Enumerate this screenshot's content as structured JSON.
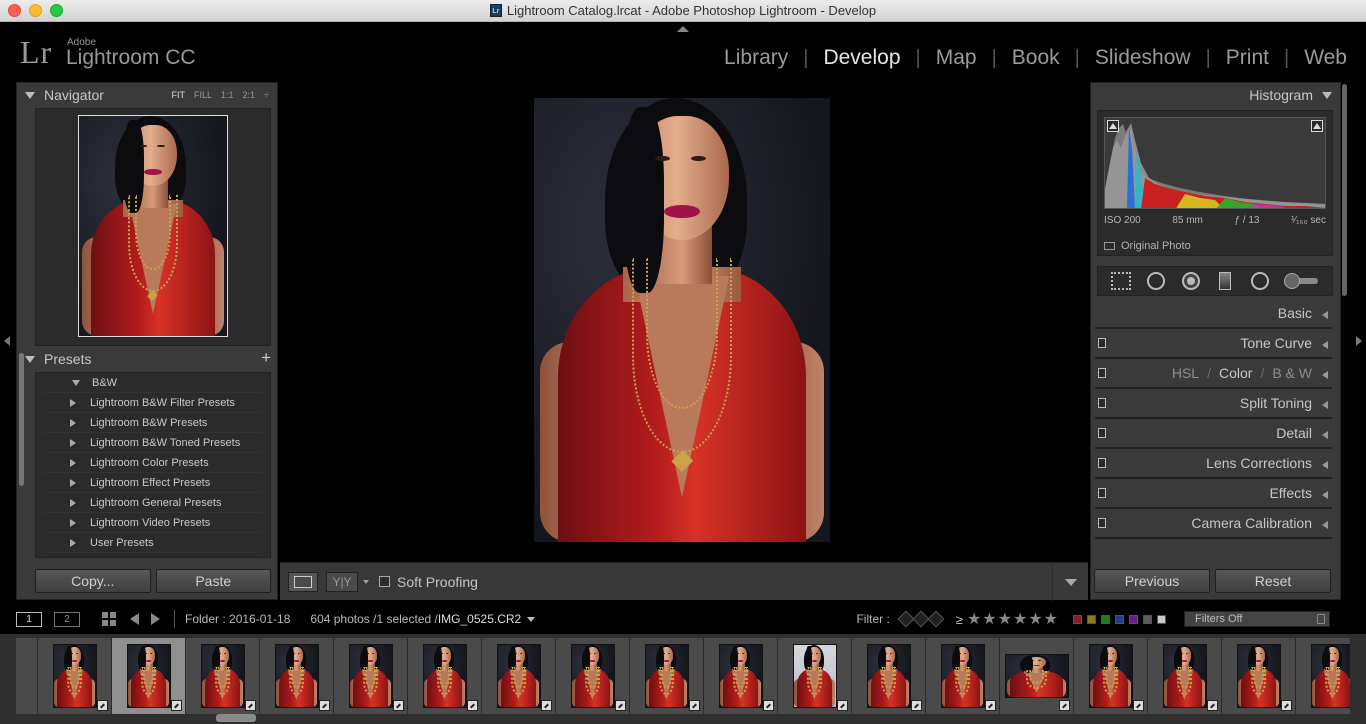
{
  "window": {
    "title": "Lightroom Catalog.lrcat - Adobe Photoshop Lightroom - Develop",
    "app_icon_text": "Lr"
  },
  "identity": {
    "logo": "Lr",
    "brand_small": "Adobe",
    "brand_big": "Lightroom CC"
  },
  "modules": [
    {
      "label": "Library",
      "active": false
    },
    {
      "label": "Develop",
      "active": true
    },
    {
      "label": "Map",
      "active": false
    },
    {
      "label": "Book",
      "active": false
    },
    {
      "label": "Slideshow",
      "active": false
    },
    {
      "label": "Print",
      "active": false
    },
    {
      "label": "Web",
      "active": false
    }
  ],
  "navigator": {
    "title": "Navigator",
    "zoom": [
      "FIT",
      "FILL",
      "1:1",
      "2:1"
    ],
    "zoom_active": "FIT",
    "zoom_more": "÷"
  },
  "presets": {
    "title": "Presets",
    "add": "+",
    "items": [
      {
        "label": "B&W",
        "expanded": true
      },
      {
        "label": "Lightroom B&W Filter Presets",
        "expanded": false
      },
      {
        "label": "Lightroom B&W Presets",
        "expanded": false
      },
      {
        "label": "Lightroom B&W Toned Presets",
        "expanded": false
      },
      {
        "label": "Lightroom Color Presets",
        "expanded": false
      },
      {
        "label": "Lightroom Effect Presets",
        "expanded": false
      },
      {
        "label": "Lightroom General Presets",
        "expanded": false
      },
      {
        "label": "Lightroom Video Presets",
        "expanded": false
      },
      {
        "label": "User Presets",
        "expanded": false
      }
    ]
  },
  "left_buttons": {
    "copy": "Copy...",
    "paste": "Paste"
  },
  "toolbar": {
    "yy_label": "Y|Y",
    "soft_proofing": "Soft Proofing",
    "soft_proofing_checked": false
  },
  "histogram": {
    "title": "Histogram",
    "iso": "ISO 200",
    "focal": "85 mm",
    "aperture": "ƒ / 13",
    "shutter": "¹⁄₁₆₀ sec",
    "original_photo": "Original Photo"
  },
  "right_sections": [
    {
      "label": "Basic",
      "switch": false
    },
    {
      "label": "Tone Curve",
      "switch": true
    },
    {
      "label": "HSL / Color / B&W",
      "switch": true,
      "parts": [
        "HSL",
        "Color",
        "B & W"
      ]
    },
    {
      "label": "Split Toning",
      "switch": true
    },
    {
      "label": "Detail",
      "switch": true
    },
    {
      "label": "Lens Corrections",
      "switch": true
    },
    {
      "label": "Effects",
      "switch": true
    },
    {
      "label": "Camera Calibration",
      "switch": true
    }
  ],
  "right_buttons": {
    "previous": "Previous",
    "reset": "Reset"
  },
  "filmstrip_header": {
    "screen1": "1",
    "screen2": "2",
    "folder": "Folder : 2016-01-18",
    "count": "604 photos /1 selected /",
    "filename": "IMG_0525.CR2",
    "filter_label": "Filter :",
    "rating_op": "≥",
    "stars": "★★★★★★",
    "filters_off": "Filters Off",
    "color_labels": [
      "#8a1f1f",
      "#8a7a1f",
      "#1f7a2a",
      "#1f3d8a",
      "#6a1f8a",
      "#5a5a5a",
      "#c8c8c8"
    ]
  },
  "filmstrip": {
    "thumbs": [
      {
        "style": "dark",
        "selected": false
      },
      {
        "style": "dark",
        "selected": true
      },
      {
        "style": "dark",
        "selected": false
      },
      {
        "style": "dark",
        "selected": false
      },
      {
        "style": "dark",
        "selected": false
      },
      {
        "style": "dark",
        "selected": false
      },
      {
        "style": "dark",
        "selected": false
      },
      {
        "style": "dark",
        "selected": false
      },
      {
        "style": "dark",
        "selected": false
      },
      {
        "style": "dark",
        "selected": false
      },
      {
        "style": "light",
        "selected": false
      },
      {
        "style": "dark",
        "selected": false
      },
      {
        "style": "dark",
        "selected": false
      },
      {
        "style": "land",
        "selected": false
      },
      {
        "style": "dark",
        "selected": false
      },
      {
        "style": "dark",
        "selected": false
      },
      {
        "style": "dark",
        "selected": false
      },
      {
        "style": "dark",
        "selected": false
      }
    ]
  },
  "colors": {
    "panel": "#3a3a3a",
    "panel_inner": "#2b2b2b",
    "accent_text": "#e6e6e6"
  }
}
